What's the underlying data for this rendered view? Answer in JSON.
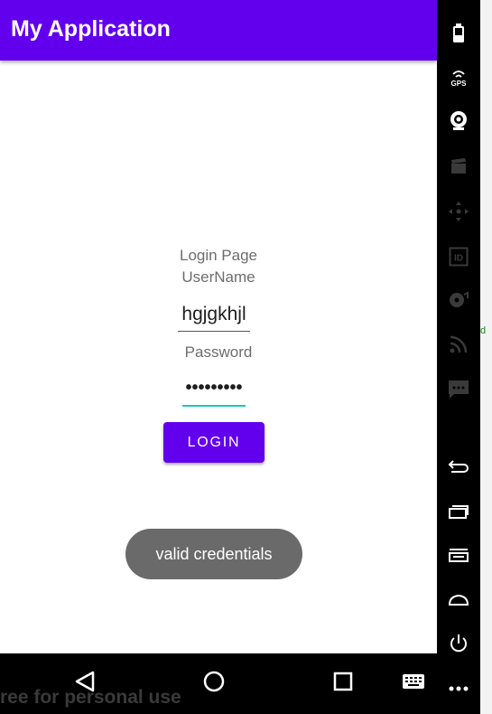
{
  "app": {
    "title": "My Application"
  },
  "form": {
    "heading": "Login Page",
    "username_label": "UserName",
    "username_value": "hgjgkhjl",
    "password_label": "Password",
    "password_value": "•••••••••",
    "login_button": "LOGIN"
  },
  "toast": {
    "message": "valid credentials"
  },
  "watermark": "ree for personal use",
  "sidebar_icons": [
    "battery-icon",
    "gps-icon",
    "camera-icon",
    "video-icon",
    "directional-pad-icon",
    "id-icon",
    "cd-icon",
    "rss-icon",
    "message-icon",
    "back-icon",
    "recent-apps-icon",
    "menu-icon",
    "home-icon",
    "power-icon",
    "more-icon"
  ],
  "nav_icons": [
    "back-triangle-icon",
    "home-circle-icon",
    "overview-square-icon",
    "keyboard-icon"
  ]
}
